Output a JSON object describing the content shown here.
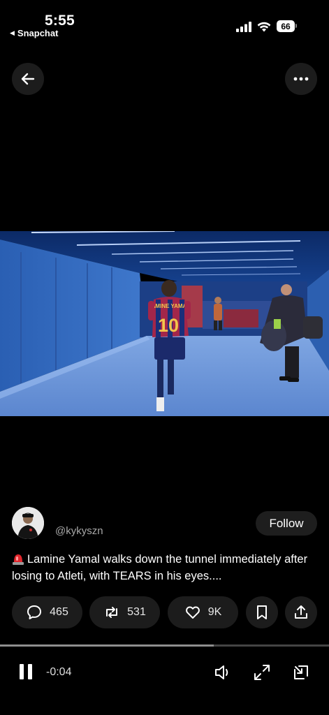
{
  "status_bar": {
    "time": "5:55",
    "back_app": "Snapchat",
    "battery": "66"
  },
  "icons": {
    "back": "arrow-left-icon",
    "more": "ellipsis-icon",
    "reply": "speech-bubble-icon",
    "repost": "repost-arrows-icon",
    "like": "heart-icon",
    "bookmark": "bookmark-icon",
    "share": "share-upload-icon",
    "pause": "pause-icon",
    "volume": "speaker-icon",
    "expand": "expand-arrows-icon",
    "pip": "picture-in-picture-icon"
  },
  "video": {
    "jersey_name": "LAMINE YAMAL",
    "jersey_number": "10"
  },
  "post": {
    "handle": "@kykyszn",
    "follow_label": "Follow",
    "caption": "Lamine Yamal walks down the tunnel immediately after losing to Atleti, with TEARS in his eyes...."
  },
  "actions": {
    "replies": "465",
    "reposts": "531",
    "likes": "9K"
  },
  "player": {
    "remaining": "-0:04",
    "progress": 0.65
  },
  "colors": {
    "background": "#000000",
    "pill": "#1c1c1c",
    "tunnel_blue": "#3a6fc0"
  }
}
